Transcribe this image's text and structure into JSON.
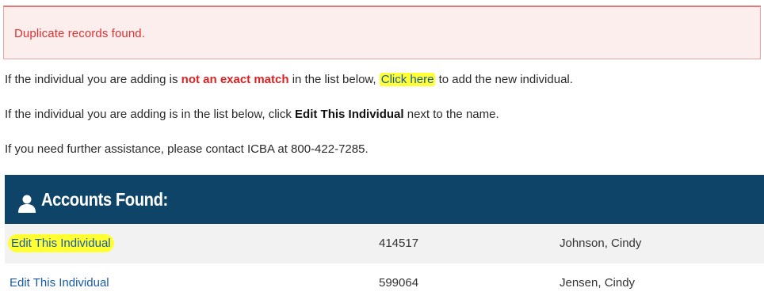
{
  "alert": {
    "message": "Duplicate records found."
  },
  "instructions": {
    "line1_pre": "If the individual you are adding is ",
    "line1_red": "not an exact match",
    "line1_mid": " in the list below, ",
    "line1_link": "Click here",
    "line1_post": " to add the new individual.",
    "line2_pre": "If the individual you are adding is in the list below, click ",
    "line2_bold": "Edit This Individual",
    "line2_post": " next to the name.",
    "line3": "If you need further assistance, please contact ICBA at 800-422-7285."
  },
  "accounts_panel": {
    "title": "Accounts Found:",
    "icon": "person-icon",
    "header_color": "#0e4468",
    "rows": [
      {
        "action": "Edit This Individual",
        "id": "414517",
        "name": "Johnson, Cindy"
      },
      {
        "action": "Edit This Individual",
        "id": "599064",
        "name": "Jensen, Cindy"
      }
    ]
  },
  "colors": {
    "alert_text": "#e03030",
    "highlight": "#ffff33",
    "link": "#1a5aa6"
  }
}
